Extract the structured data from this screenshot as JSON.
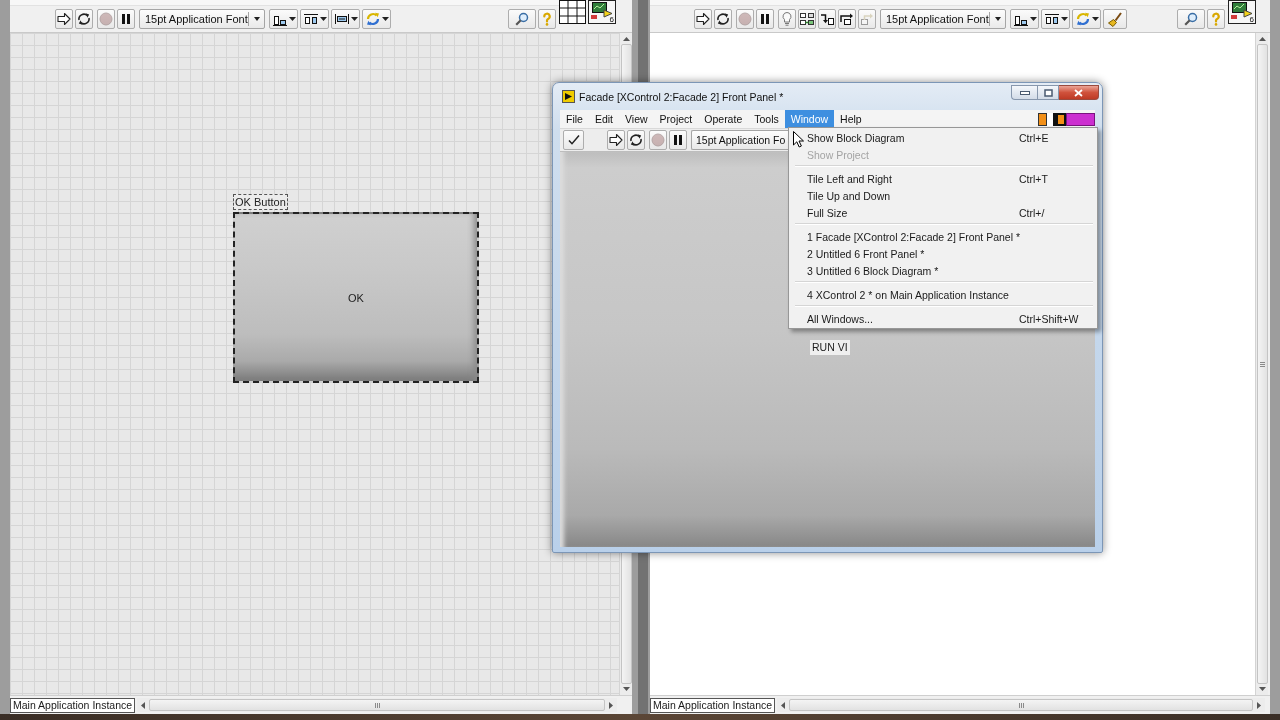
{
  "windows": [
    {
      "kind": "panel",
      "toolbar": [
        [
          {
            "kind": "run",
            "disabled": false
          },
          {
            "kind": "continuous",
            "disabled": false
          }
        ],
        [
          {
            "kind": "abort",
            "disabled": true
          },
          {
            "kind": "pause",
            "disabled": false
          }
        ],
        [
          {
            "kind": "font",
            "value": "15pt Application Font",
            "disabled": false
          }
        ],
        [
          {
            "kind": "align",
            "disabled": false
          },
          {
            "kind": "distribute",
            "disabled": false
          },
          {
            "kind": "resize",
            "disabled": false
          },
          {
            "kind": "reorder",
            "disabled": false
          }
        ]
      ],
      "toolbar_end": [
        {
          "kind": "search",
          "disabled": false
        },
        {
          "kind": "help",
          "disabled": false
        }
      ],
      "icon_number": "6",
      "controls": [
        {
          "label": "OK Button",
          "text": "OK",
          "selected": true
        }
      ],
      "status": "Main Application Instance"
    },
    {
      "kind": "diagram",
      "toolbar": [
        [
          {
            "kind": "run",
            "disabled": false
          },
          {
            "kind": "continuous",
            "disabled": false
          }
        ],
        [
          {
            "kind": "abort",
            "disabled": true
          },
          {
            "kind": "pause",
            "disabled": false
          }
        ],
        [
          {
            "kind": "highlight",
            "disabled": false
          },
          {
            "kind": "probe",
            "disabled": false
          },
          {
            "kind": "stepinto",
            "disabled": false
          },
          {
            "kind": "stepover",
            "disabled": false
          },
          {
            "kind": "stepout",
            "disabled": true
          }
        ],
        [
          {
            "kind": "font",
            "value": "15pt Application Font",
            "disabled": false
          }
        ],
        [
          {
            "kind": "align",
            "disabled": false
          },
          {
            "kind": "distribute",
            "disabled": false
          },
          {
            "kind": "reorder",
            "disabled": false
          },
          {
            "kind": "cleanup",
            "disabled": false
          }
        ]
      ],
      "toolbar_end": [
        {
          "kind": "search",
          "disabled": false
        },
        {
          "kind": "help",
          "disabled": false
        }
      ],
      "icon_number": "6",
      "status": "Main Application Instance"
    }
  ],
  "facade_window": {
    "title": "Facade [XControl 2:Facade 2] Front Panel *",
    "menu_bar": [
      {
        "label": "File",
        "selected": false
      },
      {
        "label": "Edit",
        "selected": false
      },
      {
        "label": "View",
        "selected": false
      },
      {
        "label": "Project",
        "selected": false
      },
      {
        "label": "Operate",
        "selected": false
      },
      {
        "label": "Tools",
        "selected": false
      },
      {
        "label": "Window",
        "selected": true
      },
      {
        "label": "Help",
        "selected": false
      }
    ],
    "toolbar": [
      [
        {
          "kind": "apply",
          "disabled": false
        }
      ],
      [
        {
          "kind": "run",
          "disabled": false
        },
        {
          "kind": "continuous",
          "disabled": false
        }
      ],
      [
        {
          "kind": "abort",
          "disabled": true
        },
        {
          "kind": "pause",
          "disabled": false
        }
      ],
      [
        {
          "kind": "font",
          "value": "15pt Application Fo",
          "disabled": false
        }
      ]
    ],
    "labels": [
      "RUN VI"
    ]
  },
  "window_menu": {
    "groups": [
      [
        {
          "label": "Show Block Diagram",
          "shortcut": "Ctrl+E",
          "disabled": false
        },
        {
          "label": "Show Project",
          "disabled": true
        }
      ],
      [
        {
          "label": "Tile Left and Right",
          "shortcut": "Ctrl+T",
          "disabled": false
        },
        {
          "label": "Tile Up and Down",
          "disabled": false
        },
        {
          "label": "Full Size",
          "shortcut": "Ctrl+/",
          "disabled": false
        }
      ],
      [
        {
          "label": "1 Facade [XControl 2:Facade 2] Front Panel *",
          "disabled": false
        },
        {
          "label": "2 Untitled 6 Front Panel *",
          "disabled": false
        },
        {
          "label": "3 Untitled 6 Block Diagram *",
          "disabled": false
        }
      ],
      [
        {
          "label": "4 XControl 2 * on Main Application Instance",
          "disabled": false
        }
      ],
      [
        {
          "label": "All Windows...",
          "shortcut": "Ctrl+Shift+W",
          "disabled": false
        }
      ]
    ]
  }
}
